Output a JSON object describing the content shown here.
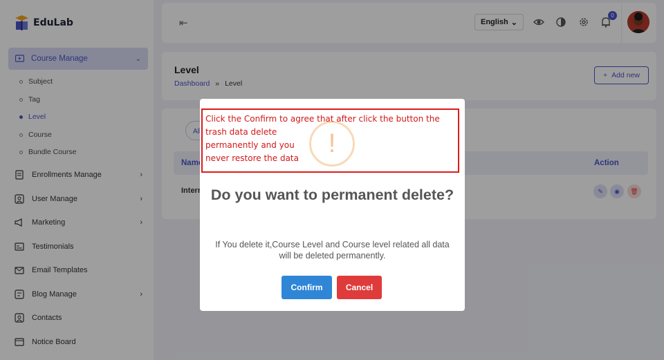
{
  "app": {
    "name": "EduLab"
  },
  "sidebar": {
    "active_group": "Course Manage",
    "sub_items": [
      {
        "label": "Subject"
      },
      {
        "label": "Tag"
      },
      {
        "label": "Level"
      },
      {
        "label": "Course"
      },
      {
        "label": "Bundle Course"
      }
    ],
    "items": [
      {
        "label": "Enrollments Manage",
        "icon": "enrollment-icon"
      },
      {
        "label": "User Manage",
        "icon": "user-icon"
      },
      {
        "label": "Marketing",
        "icon": "megaphone-icon"
      },
      {
        "label": "Testimonials",
        "icon": "testimonial-icon"
      },
      {
        "label": "Email Templates",
        "icon": "mail-icon"
      },
      {
        "label": "Blog Manage",
        "icon": "blog-icon"
      },
      {
        "label": "Contacts",
        "icon": "contact-icon"
      },
      {
        "label": "Notice Board",
        "icon": "notice-icon"
      }
    ]
  },
  "header": {
    "language": "English",
    "notification_count": "0"
  },
  "page": {
    "title": "Level",
    "breadcrumb_root": "Dashboard",
    "breadcrumb_sep": "»",
    "breadcrumb_current": "Level",
    "add_button": "Add new"
  },
  "table": {
    "filter_pill": "All",
    "col_name": "Name",
    "col_action": "Action",
    "row_name": "Intermediate"
  },
  "modal": {
    "icon_symbol": "!",
    "title": "Do you want to permanent delete?",
    "text": "If You delete it,Course Level and Course level related all data will be deleted permanently.",
    "confirm": "Confirm",
    "cancel": "Cancel"
  },
  "annotation": {
    "line1": "Click the Confirm to agree that after click the button the",
    "line2": "trash data delete",
    "line3": "permanently and you",
    "line4": "never restore the data"
  },
  "colors": {
    "primary": "#4a55c9",
    "confirm": "#2f86d6",
    "cancel": "#df3b3b",
    "annotation": "#d01818"
  }
}
